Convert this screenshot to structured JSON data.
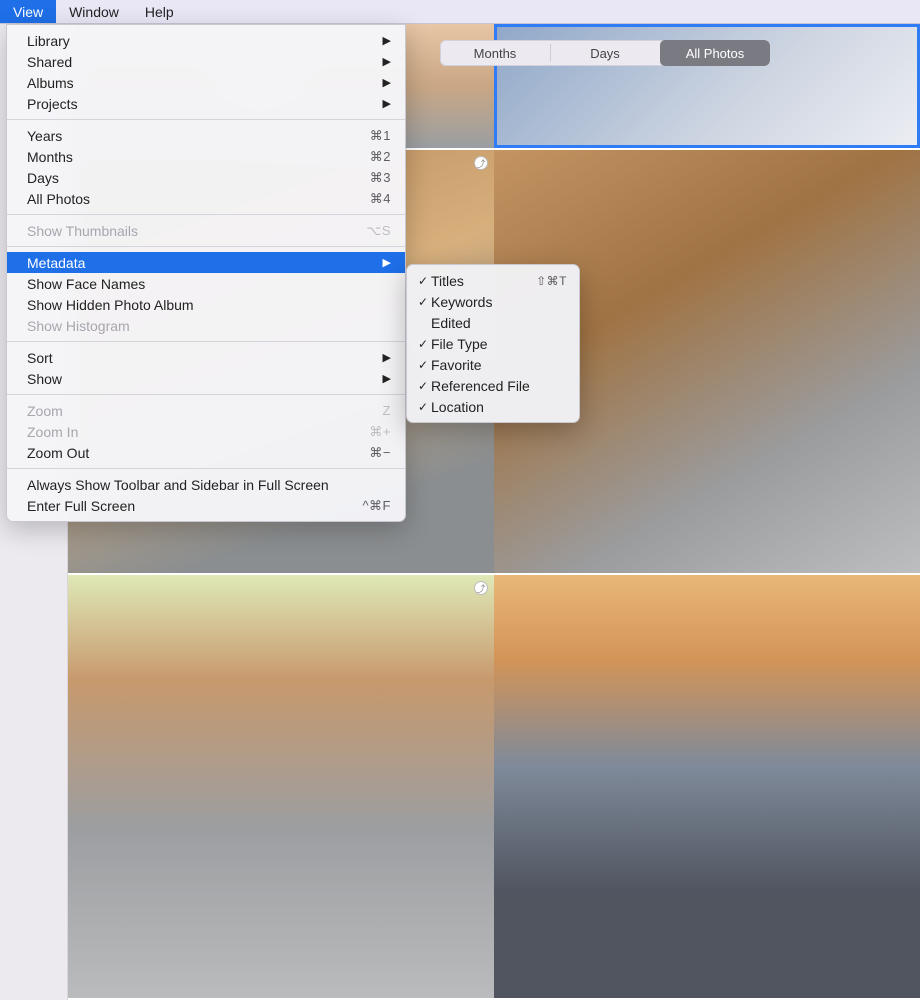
{
  "menubar": {
    "view": "View",
    "window": "Window",
    "help": "Help"
  },
  "view_tabs": {
    "months": "Months",
    "days": "Days",
    "all_photos": "All Photos"
  },
  "view_menu": {
    "library": "Library",
    "shared": "Shared",
    "albums": "Albums",
    "projects": "Projects",
    "years": "Years",
    "years_sc": "⌘1",
    "months": "Months",
    "months_sc": "⌘2",
    "days": "Days",
    "days_sc": "⌘3",
    "all_photos": "All Photos",
    "all_photos_sc": "⌘4",
    "show_thumbnails": "Show Thumbnails",
    "show_thumbnails_sc": "⌥S",
    "metadata": "Metadata",
    "show_face_names": "Show Face Names",
    "show_hidden": "Show Hidden Photo Album",
    "show_histogram": "Show Histogram",
    "sort": "Sort",
    "show": "Show",
    "zoom": "Zoom",
    "zoom_sc": "Z",
    "zoom_in": "Zoom In",
    "zoom_in_sc": "⌘+",
    "zoom_out": "Zoom Out",
    "zoom_out_sc": "⌘−",
    "always_toolbar": "Always Show Toolbar and Sidebar in Full Screen",
    "enter_full": "Enter Full Screen",
    "enter_full_sc": "^⌘F"
  },
  "metadata_submenu": {
    "titles": "Titles",
    "titles_sc": "⇧⌘T",
    "keywords": "Keywords",
    "edited": "Edited",
    "file_type": "File Type",
    "favorite": "Favorite",
    "referenced_file": "Referenced File",
    "location": "Location"
  }
}
